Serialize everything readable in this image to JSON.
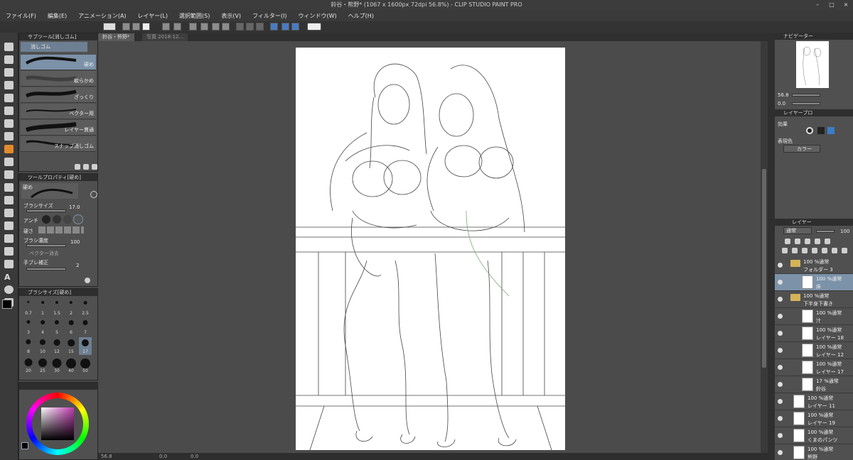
{
  "window": {
    "title": "鈴谷・熊野* (1067 x 1600px 72dpi 56.8%) - CLIP STUDIO PAINT PRO"
  },
  "menu": [
    "ファイル(F)",
    "編集(E)",
    "アニメーション(A)",
    "レイヤー(L)",
    "選択範囲(S)",
    "表示(V)",
    "フィルター(I)",
    "ウィンドウ(W)",
    "ヘルプ(H)"
  ],
  "tabs": [
    "鈴谷・熊野*",
    "写真 2018-12..."
  ],
  "subtool": {
    "header": "サブツール[消しゴム]",
    "group": "消しゴム",
    "items": [
      "硬め",
      "軟らかめ",
      "ざっくり",
      "ベクター用",
      "レイヤー貫通",
      "スナップ消しゴム"
    ]
  },
  "toolprop": {
    "header": "ツールプロパティ[硬め]",
    "preset": "硬め",
    "brush_size_label": "ブラシサイズ",
    "brush_size_value": "17.0",
    "anti_label": "アンチ",
    "hardness_label": "硬さ",
    "density_label": "ブラシ濃度",
    "density_value": "100",
    "vector_label": "ベクター消去",
    "stab_label": "手ブレ補正",
    "stab_value": "2"
  },
  "brushsize": {
    "header": "ブラシサイズ[硬め]",
    "sizes": [
      "0.7",
      "1",
      "1.5",
      "2",
      "2.5",
      "3",
      "4",
      "5",
      "6",
      "7",
      "8",
      "10",
      "12",
      "15",
      "17",
      "20",
      "25",
      "30",
      "40",
      "50"
    ]
  },
  "navigator": {
    "header": "ナビゲーター",
    "zoom": "56.8",
    "rotate": "0.0"
  },
  "layerprop": {
    "header": "レイヤープロ",
    "effect_label": "効果",
    "color_label": "表現色",
    "color_value": "カラー"
  },
  "layers": {
    "header": "レイヤー",
    "blend": "通常",
    "opacity": "100",
    "items": [
      {
        "t1": "100 %通常",
        "t2": "フォルダー 3",
        "folder": true,
        "ind": 0
      },
      {
        "t1": "100 %通常",
        "t2": "床",
        "folder": false,
        "ind": 1,
        "sel": true
      },
      {
        "t1": "100 %通常",
        "t2": "下半身下書き",
        "folder": true,
        "ind": 0
      },
      {
        "t1": "100 %通常",
        "t2": "汁",
        "folder": false,
        "ind": 1
      },
      {
        "t1": "100 %通常",
        "t2": "レイヤー 18",
        "folder": false,
        "ind": 1
      },
      {
        "t1": "100 %通常",
        "t2": "レイヤー 12",
        "folder": false,
        "ind": 1
      },
      {
        "t1": "100 %通常",
        "t2": "レイヤー 17",
        "folder": false,
        "ind": 1
      },
      {
        "t1": "17 %通常",
        "t2": "鈴谷",
        "folder": false,
        "ind": 1
      },
      {
        "t1": "100 %通常",
        "t2": "レイヤー 11",
        "folder": false,
        "ind": 0
      },
      {
        "t1": "100 %通常",
        "t2": "レイヤー 19",
        "folder": false,
        "ind": 0
      },
      {
        "t1": "100 %通常",
        "t2": "くまのパンツ",
        "folder": false,
        "ind": 0
      },
      {
        "t1": "100 %通常",
        "t2": "熊野",
        "folder": false,
        "ind": 0
      }
    ]
  },
  "status": {
    "zoom": "56.8",
    "a": "0.0",
    "b": "0.0"
  },
  "colors": {
    "accent": "#e28a2b",
    "selected_layer": "#7c92a9"
  }
}
